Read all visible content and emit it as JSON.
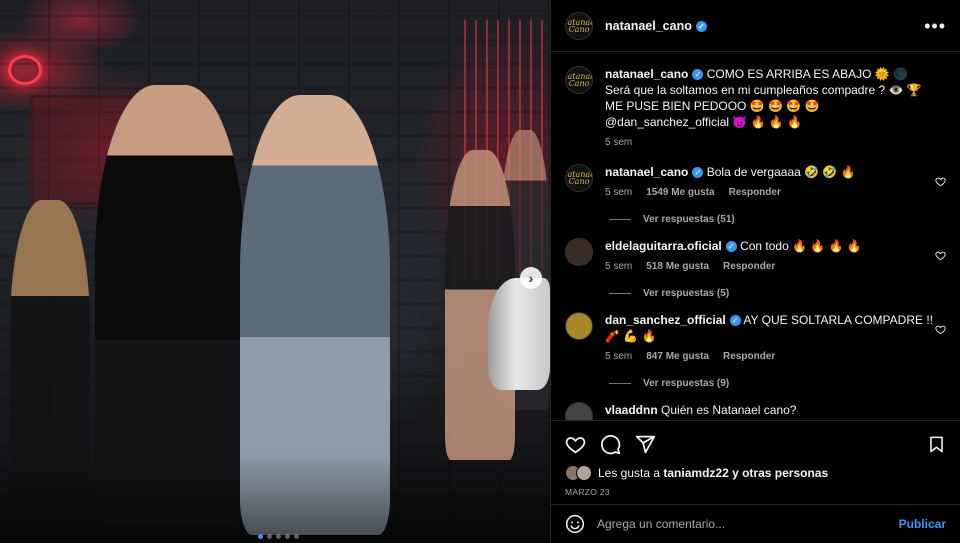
{
  "post": {
    "username": "natanael_cano",
    "avatar_text": "Natanael Cano",
    "more_icon": "more-horizontal-icon",
    "carousel": {
      "total": 5,
      "active": 0,
      "next_icon": "chevron-right-icon"
    }
  },
  "caption": {
    "username": "natanael_cano",
    "text": "COMO ES ARRIBA ES ABAJO 🌞 🌑 Será que la soltamos en mi cumpleaños compadre ? 👁️ 🏆 ME PUSE BIEN PEDOOO 🤩 🤩 🤩 🤩 @dan_sanchez_official 😈 🔥 🔥 🔥",
    "time": "5 sem"
  },
  "comments": [
    {
      "username": "natanael_cano",
      "verified": true,
      "text": "Bola de vergaaaa 🤣 🤣 🔥",
      "time": "5 sem",
      "likes": "1549 Me gusta",
      "reply_label": "Responder",
      "view_replies": "Ver respuestas (51)"
    },
    {
      "username": "eldelaguitarra.oficial",
      "verified": true,
      "text": "Con todo 🔥 🔥 🔥 🔥",
      "time": "5 sem",
      "likes": "518 Me gusta",
      "reply_label": "Responder",
      "view_replies": "Ver respuestas (5)"
    },
    {
      "username": "dan_sanchez_official",
      "verified": true,
      "text": "AY QUE SOLTARLA COMPADRE !! 🧨 💪 🔥",
      "time": "5 sem",
      "likes": "847 Me gusta",
      "reply_label": "Responder",
      "view_replies": "Ver respuestas (9)"
    },
    {
      "username": "vlaaddnn",
      "verified": false,
      "text": "Quién es Natanael cano?",
      "time": "",
      "likes": "",
      "reply_label": "",
      "view_replies": ""
    }
  ],
  "actions": {
    "liked_by_prefix": "Les gusta a",
    "liked_by_user": "taniamdz22",
    "liked_by_suffix": "y otras personas",
    "date": "MARZO 23"
  },
  "composer": {
    "placeholder": "Agrega un comentario...",
    "publish_label": "Publicar"
  },
  "colors": {
    "accent": "#3897f0",
    "background": "#000000",
    "muted": "#a8a8a8"
  }
}
